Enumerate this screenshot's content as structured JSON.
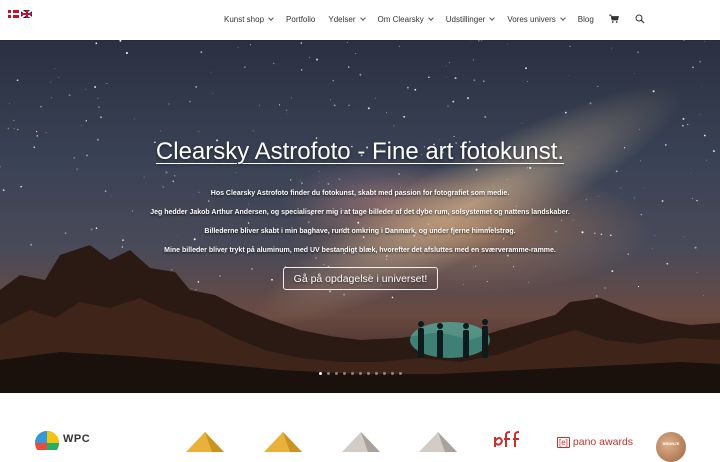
{
  "header": {
    "flags": [
      "danish-flag",
      "english-flag"
    ],
    "nav": [
      {
        "label": "Kunst shop",
        "dropdown": true
      },
      {
        "label": "Portfolio",
        "dropdown": false
      },
      {
        "label": "Ydelser",
        "dropdown": true
      },
      {
        "label": "Om Clearsky",
        "dropdown": true
      },
      {
        "label": "Udstillinger",
        "dropdown": true
      },
      {
        "label": "Vores univers",
        "dropdown": true
      },
      {
        "label": "Blog",
        "dropdown": false
      }
    ],
    "icons": [
      "cart-icon",
      "search-icon"
    ]
  },
  "hero": {
    "title": "Clearsky Astrofoto - Fine art fotokunst.",
    "paragraphs": [
      "Hos Clearsky Astrofoto finder du fotokunst, skabt med passion for fotografiet som medie.",
      "Jeg hedder Jakob Arthur Andersen, og specialiserer mig i at tage billeder af det dybe rum, solsystemet og nattens landskaber.",
      "Billederne bliver skabt i min baghave, rundt omkring i Danmark, og under fjerne himmelstrøg.",
      "Mine billeder bliver trykt på aluminum, med UV bestandigt blæk, hvorefter det afsluttes med en sværveramme-ramme."
    ],
    "cta": "Gå på opdagelse i universet!",
    "slider": {
      "count": 11,
      "active": 1
    }
  },
  "logos": {
    "wpc_text": "WPC",
    "pano_text": "pano awards",
    "pano_prefix": "[e]",
    "bronze_text": "BRONZE",
    "items": [
      "wpc-logo",
      "award-badge-1",
      "award-badge-2",
      "award-badge-3",
      "award-badge-4",
      "dff-logo",
      "pano-awards-logo",
      "bronze-medal"
    ]
  },
  "colors": {
    "accent": "#c8302a",
    "nav_text": "#333333",
    "gold": "#e8b23a",
    "silver": "#c9c3bd"
  }
}
